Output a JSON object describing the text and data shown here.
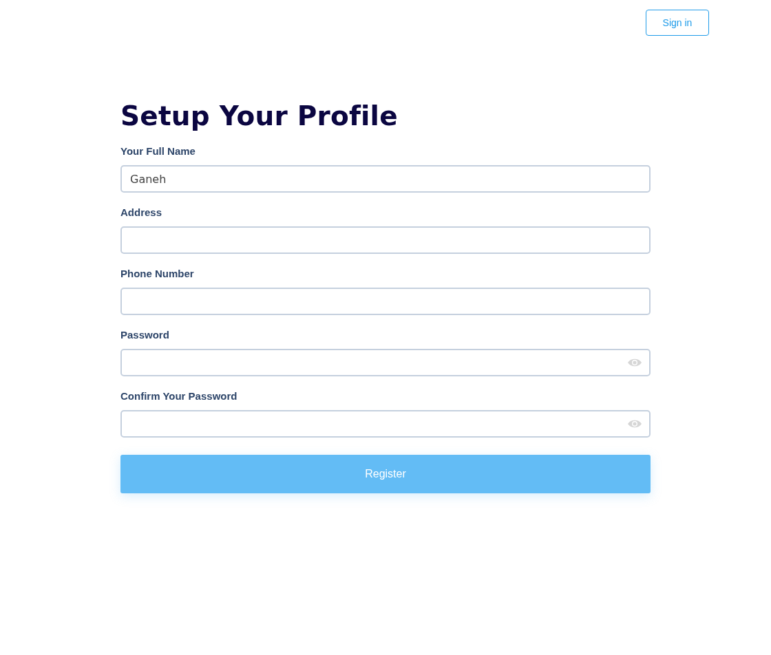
{
  "header": {
    "sign_in": "Sign in"
  },
  "title": "Setup Your Profile",
  "fields": [
    {
      "label": "Your Full Name",
      "kind": "text",
      "value": "Ganeh"
    },
    {
      "label": "Address",
      "kind": "text"
    },
    {
      "label": "Phone Number",
      "kind": "text"
    },
    {
      "label": "Password",
      "kind": "password"
    },
    {
      "label": "Confirm Your Password",
      "kind": "password"
    }
  ],
  "submit": "Register"
}
